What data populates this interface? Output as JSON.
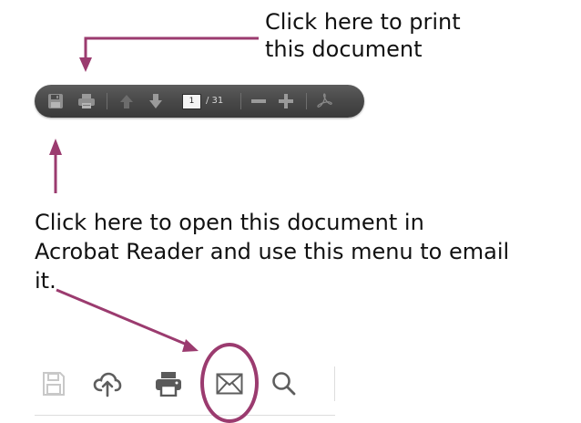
{
  "annotations": {
    "print_note_line1": "Click here to print",
    "print_note_line2": "this document",
    "acrobat_note_line1": "Click here to open this document in",
    "acrobat_note_line2": "Acrobat Reader and use this menu to email",
    "acrobat_note_line3": "it."
  },
  "pdf_toolbar": {
    "current_page": "1",
    "page_count": "/ 31",
    "icons": [
      "save-icon",
      "print-icon",
      "page-up-icon",
      "page-down-icon",
      "zoom-out-icon",
      "zoom-in-icon",
      "acrobat-icon"
    ]
  },
  "reader_toolbar": {
    "icons": [
      "save-icon",
      "cloud-upload-icon",
      "print-icon",
      "email-icon",
      "search-icon"
    ]
  },
  "colors": {
    "annotation_accent": "#9b3b6f",
    "toolbar_background": "#4a4a4a"
  }
}
